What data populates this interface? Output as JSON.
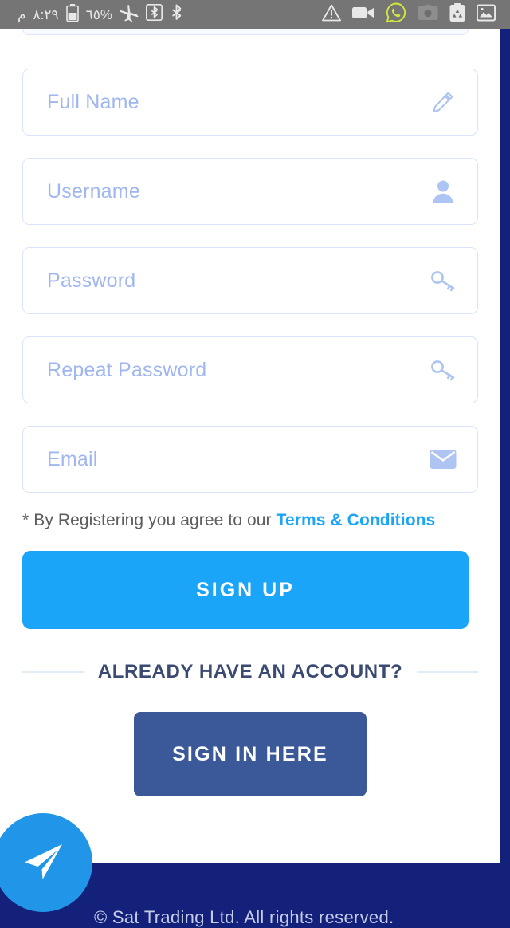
{
  "statusbar": {
    "meridiem": "م",
    "time": "٨:٢٩",
    "battery_pct": "٦٥%",
    "left_icons": [
      "battery-icon",
      "airplane-mode-icon",
      "bluetooth-box-icon",
      "bluetooth-icon"
    ],
    "right_icons": [
      "warning-icon",
      "video-camera-icon",
      "whatsapp-icon",
      "camera-icon",
      "recycle-clipboard-icon",
      "gallery-icon"
    ],
    "bg_color": "#757575"
  },
  "form": {
    "fields": [
      {
        "name": "full-name",
        "placeholder": "Full Name",
        "icon": "pencil-icon"
      },
      {
        "name": "username",
        "placeholder": "Username",
        "icon": "person-icon"
      },
      {
        "name": "password",
        "placeholder": "Password",
        "icon": "key-icon"
      },
      {
        "name": "repeat-password",
        "placeholder": "Repeat Password",
        "icon": "key-icon"
      },
      {
        "name": "email",
        "placeholder": "Email",
        "icon": "envelope-icon"
      }
    ],
    "terms_prefix": "* By Registering you agree to our ",
    "terms_link": "Terms & Conditions",
    "signup_label": "SIGN UP",
    "divider_label": "ALREADY HAVE AN ACCOUNT?",
    "signin_label": "SIGN IN HERE"
  },
  "footer": {
    "fab_icon": "send-paper-plane-icon",
    "text": "© Sat Trading Ltd. All rights reserved.",
    "bg_color": "#14217A"
  },
  "colors": {
    "accent_blue": "#1BA5F8",
    "signin_navy": "#3B5998",
    "footer_navy": "#14217A",
    "placeholder": "#9fb6f0",
    "field_border": "#d9e3fb",
    "divider_text": "#3a4a72"
  }
}
